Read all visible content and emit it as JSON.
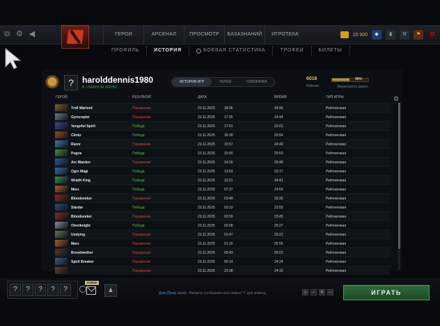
{
  "topbar": {
    "nav": [
      "ГЕРОИ",
      "АРСЕНАЛ",
      "ПРОСМОТР",
      "БАЗАЗНАНИЙ",
      "ИГРОТЕКА"
    ],
    "shards": "16 900"
  },
  "subnav": [
    "ПРОФИЛЬ",
    "ИСТОРИЯ",
    "БОЕВАЯ СТАТИСТИКА",
    "ТРОФЕИ",
    "БИЛЕТЫ"
  ],
  "profile": {
    "avatar_glyph": "?",
    "username": "harolddennis1980",
    "subline": "В ГЛАВНОМ МЕНЮ",
    "tabs": [
      "ИСТОРИЯ ИГР",
      "ГЕРОИ",
      "СОЮЗНИКИ"
    ],
    "rating_value": "6016",
    "rating_label": "Рейтинг",
    "confidence_value": "48%",
    "confidence_fraction": 0.48,
    "confidence_label": "Уверенность ранга"
  },
  "table": {
    "headers": {
      "hero": "ГЕРОЙ",
      "result": "РЕЗУЛЬТАТ",
      "date": "ДАТА",
      "time": "ВРЕМЯ",
      "type": "ТИП ИГРЫ"
    },
    "rows": [
      {
        "hero": "Troll Warlord",
        "result": "Поражение",
        "win": false,
        "date": "23.11.2025",
        "clock": "18:06",
        "duration": "24:40",
        "type": "Рейтинговая",
        "color": "#8a5a2a"
      },
      {
        "hero": "Gyrocopter",
        "result": "Поражение",
        "win": false,
        "date": "23.11.2025",
        "clock": "17:35",
        "duration": "24:44",
        "type": "Рейтинговая",
        "color": "#6a7a8a"
      },
      {
        "hero": "Vengeful Spirit",
        "result": "Победа",
        "win": true,
        "date": "23.11.2025",
        "clock": "17:01",
        "duration": "23:01",
        "type": "Рейтинговая",
        "color": "#3a4a8a"
      },
      {
        "hero": "Clinkz",
        "result": "Победа",
        "win": true,
        "date": "23.11.2025",
        "clock": "16:28",
        "duration": "25:54",
        "type": "Рейтинговая",
        "color": "#9a4a1a"
      },
      {
        "hero": "Razor",
        "result": "Поражение",
        "win": false,
        "date": "23.11.2025",
        "clock": "15:57",
        "duration": "24:40",
        "type": "Рейтинговая",
        "color": "#3a7aaa"
      },
      {
        "hero": "Pugna",
        "result": "Победа",
        "win": true,
        "date": "23.11.2025",
        "clock": "15:00",
        "duration": "25:53",
        "type": "Рейтинговая",
        "color": "#4a8a3a"
      },
      {
        "hero": "Arc Warden",
        "result": "Поражение",
        "win": false,
        "date": "23.11.2025",
        "clock": "14:30",
        "duration": "23:49",
        "type": "Рейтинговая",
        "color": "#2a5a9a"
      },
      {
        "hero": "Ogre Magi",
        "result": "Победа",
        "win": true,
        "date": "23.11.2025",
        "clock": "13:53",
        "duration": "23:17",
        "type": "Рейтинговая",
        "color": "#3a6aaa"
      },
      {
        "hero": "Wraith King",
        "result": "Победа",
        "win": true,
        "date": "23.11.2025",
        "clock": "13:21",
        "duration": "24:41",
        "type": "Рейтинговая",
        "color": "#3a8a4a"
      },
      {
        "hero": "Mars",
        "result": "Победа",
        "win": true,
        "date": "23.11.2025",
        "clock": "07:37",
        "duration": "24:03",
        "type": "Рейтинговая",
        "color": "#aa5a2a"
      },
      {
        "hero": "Bloodseeker",
        "result": "Поражение",
        "win": false,
        "date": "23.11.2025",
        "clock": "03:49",
        "duration": "23:26",
        "type": "Рейтинговая",
        "color": "#8a2a1a"
      },
      {
        "hero": "Slardar",
        "result": "Победа",
        "win": true,
        "date": "23.11.2025",
        "clock": "03:19",
        "duration": "23:55",
        "type": "Рейтинговая",
        "color": "#2a4a7a"
      },
      {
        "hero": "Bloodseeker",
        "result": "Поражение",
        "win": false,
        "date": "23.11.2025",
        "clock": "02:59",
        "duration": "23:45",
        "type": "Рейтинговая",
        "color": "#8a2a1a"
      },
      {
        "hero": "Omniknight",
        "result": "Победа",
        "win": true,
        "date": "23.11.2025",
        "clock": "02:08",
        "duration": "25:27",
        "type": "Рейтинговая",
        "color": "#8a8a9a"
      },
      {
        "hero": "Undying",
        "result": "Поражение",
        "win": false,
        "date": "23.11.2025",
        "clock": "01:47",
        "duration": "23:21",
        "type": "Рейтинговая",
        "color": "#5a7a4a"
      },
      {
        "hero": "Mars",
        "result": "Поражение",
        "win": false,
        "date": "23.11.2025",
        "clock": "01:16",
        "duration": "25:56",
        "type": "Рейтинговая",
        "color": "#aa5a2a"
      },
      {
        "hero": "Broodmother",
        "result": "Поражение",
        "win": false,
        "date": "23.11.2025",
        "clock": "00:43",
        "duration": "25:01",
        "type": "Рейтинговая",
        "color": "#4a3a2a"
      },
      {
        "hero": "Spirit Breaker",
        "result": "Поражение",
        "win": false,
        "date": "23.11.2025",
        "clock": "00:14",
        "duration": "24:24",
        "type": "Рейтинговая",
        "color": "#3a5a8a"
      },
      {
        "hero": "",
        "result": "Поражение",
        "win": false,
        "date": "23.11.2025",
        "clock": "23:38",
        "duration": "24:10",
        "type": "Рейтинговая",
        "color": "#6a3a2a"
      }
    ]
  },
  "bottom": {
    "party_slots": [
      "?",
      "?",
      "?",
      "?",
      "?"
    ],
    "mail_badge": "НОВОЕ",
    "chat_channel": "Дом (Пред. игра):",
    "chat_placeholder": "Введите сообщение или символ \"/\" для команд.",
    "play_label": "ИГРАТЬ"
  }
}
